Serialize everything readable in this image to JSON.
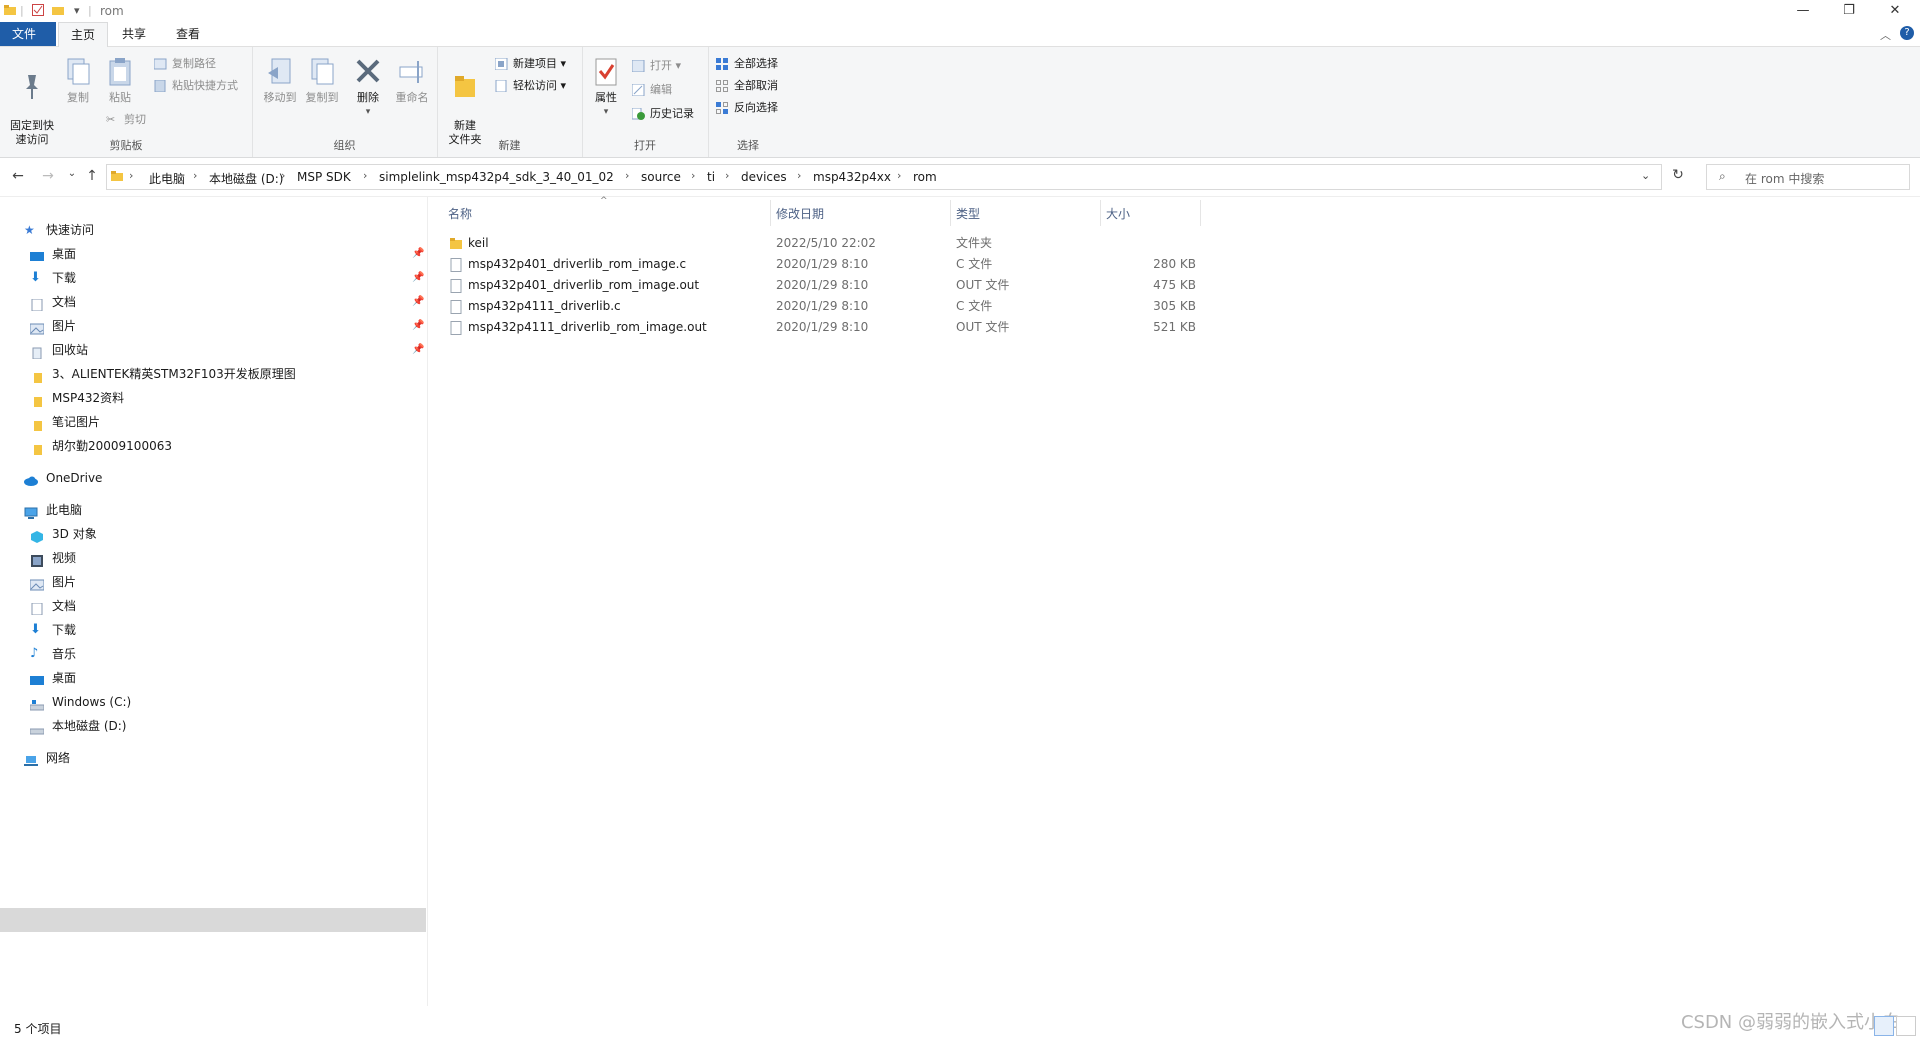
{
  "window": {
    "title": "rom"
  },
  "tabs": [
    "文件",
    "主页",
    "共享",
    "查看"
  ],
  "ribbon": {
    "clipboard": {
      "label": "剪贴板",
      "pin": "固定到快\n速访问",
      "copy": "复制",
      "paste": "粘贴",
      "copy_path": "复制路径",
      "paste_shortcut": "粘贴快捷方式",
      "cut": "剪切"
    },
    "organize": {
      "label": "组织",
      "move_to": "移动到",
      "copy_to": "复制到",
      "delete": "删除",
      "rename": "重命名"
    },
    "new": {
      "label": "新建",
      "new_folder": "新建\n文件夹",
      "new_item": "新建项目 ▾",
      "easy_access": "轻松访问 ▾"
    },
    "open": {
      "label": "打开",
      "properties": "属性",
      "open": "打开 ▾",
      "edit": "编辑",
      "history": "历史记录"
    },
    "select": {
      "label": "选择",
      "select_all": "全部选择",
      "select_none": "全部取消",
      "invert": "反向选择"
    }
  },
  "breadcrumb": [
    "此电脑",
    "本地磁盘 (D:)",
    "MSP SDK",
    "simplelink_msp432p4_sdk_3_40_01_02",
    "source",
    "ti",
    "devices",
    "msp432p4xx",
    "rom"
  ],
  "search": {
    "placeholder": "在 rom 中搜索"
  },
  "sidebar": {
    "quick_access": "快速访问",
    "quick_items": [
      "桌面",
      "下载",
      "文档",
      "图片",
      "回收站",
      "3、ALIENTEK精英STM32F103开发板原理图",
      "MSP432资料",
      "笔记图片",
      "胡尔勤20009100063"
    ],
    "onedrive": "OneDrive",
    "this_pc": "此电脑",
    "pc_items": [
      "3D 对象",
      "视频",
      "图片",
      "文档",
      "下载",
      "音乐",
      "桌面",
      "Windows (C:)",
      "本地磁盘 (D:)"
    ],
    "network": "网络"
  },
  "columns": {
    "name": "名称",
    "date": "修改日期",
    "type": "类型",
    "size": "大小"
  },
  "files": [
    {
      "name": "keil",
      "date": "2022/5/10 22:02",
      "type": "文件夹",
      "size": ""
    },
    {
      "name": "msp432p401_driverlib_rom_image.c",
      "date": "2020/1/29 8:10",
      "type": "C 文件",
      "size": "280 KB"
    },
    {
      "name": "msp432p401_driverlib_rom_image.out",
      "date": "2020/1/29 8:10",
      "type": "OUT 文件",
      "size": "475 KB"
    },
    {
      "name": "msp432p4111_driverlib.c",
      "date": "2020/1/29 8:10",
      "type": "C 文件",
      "size": "305 KB"
    },
    {
      "name": "msp432p4111_driverlib_rom_image.out",
      "date": "2020/1/29 8:10",
      "type": "OUT 文件",
      "size": "521 KB"
    }
  ],
  "status": {
    "count": "5 个项目"
  },
  "watermark": "CSDN @弱弱的嵌入式小白",
  "colors": {
    "accent": "#1f5da8",
    "folder": "#f4c542",
    "selected": "#d9d9d9"
  }
}
